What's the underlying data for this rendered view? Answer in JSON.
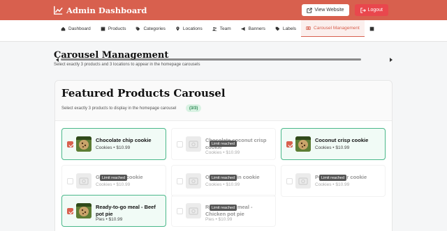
{
  "header": {
    "title": "Admin Dashboard",
    "view_website": "View Website",
    "logout": "Logout",
    "brand_color": "#d8604e"
  },
  "nav": {
    "items": [
      {
        "label": "Dashboard",
        "icon": "home-icon"
      },
      {
        "label": "Products",
        "icon": "box-icon"
      },
      {
        "label": "Categories",
        "icon": "tag-icon"
      },
      {
        "label": "Locations",
        "icon": "map-pin-icon"
      },
      {
        "label": "Team",
        "icon": "users-icon"
      },
      {
        "label": "Banners",
        "icon": "megaphone-icon"
      },
      {
        "label": "Labels",
        "icon": "tags-icon"
      },
      {
        "label": "Carousel Management",
        "icon": "carousel-icon",
        "active": true
      }
    ]
  },
  "page": {
    "title": "Carousel Management",
    "subtitle": "Select exactly 3 products and 3 locations to appear in the homepage carousels"
  },
  "featured": {
    "title": "Featured Products Carousel",
    "description": "Select exactly 3 products to display in the homepage carousel",
    "count": "(3/3)",
    "limit_label": "Limit reached",
    "products": [
      {
        "name": "Chocolate chip cookie",
        "meta": "Cookies • $10.99",
        "selected": true,
        "has_image": true
      },
      {
        "name": "Chocolate coconut crisp cookie",
        "meta": "Cookies • $10.99",
        "selected": false,
        "has_image": false
      },
      {
        "name": "Coconut crisp cookie",
        "meta": "Cookies • $10.99",
        "selected": true,
        "has_image": true
      },
      {
        "name": "Gingersnap cookie",
        "meta": "Cookies • $10.99",
        "selected": false,
        "has_image": false
      },
      {
        "name": "Oatmeal raisin cookie",
        "meta": "Cookies • $10.99",
        "selected": false,
        "has_image": false
      },
      {
        "name": "Peanut butter cookie",
        "meta": "Cookies • $10.99",
        "selected": false,
        "has_image": false
      },
      {
        "name": "Ready-to-go meal - Beef pot pie",
        "meta": "Pies • $10.99",
        "selected": true,
        "has_image": true
      },
      {
        "name": "Ready-to-go meal - Chicken pot pie",
        "meta": "Pies • $10.99",
        "selected": false,
        "has_image": false
      }
    ]
  }
}
